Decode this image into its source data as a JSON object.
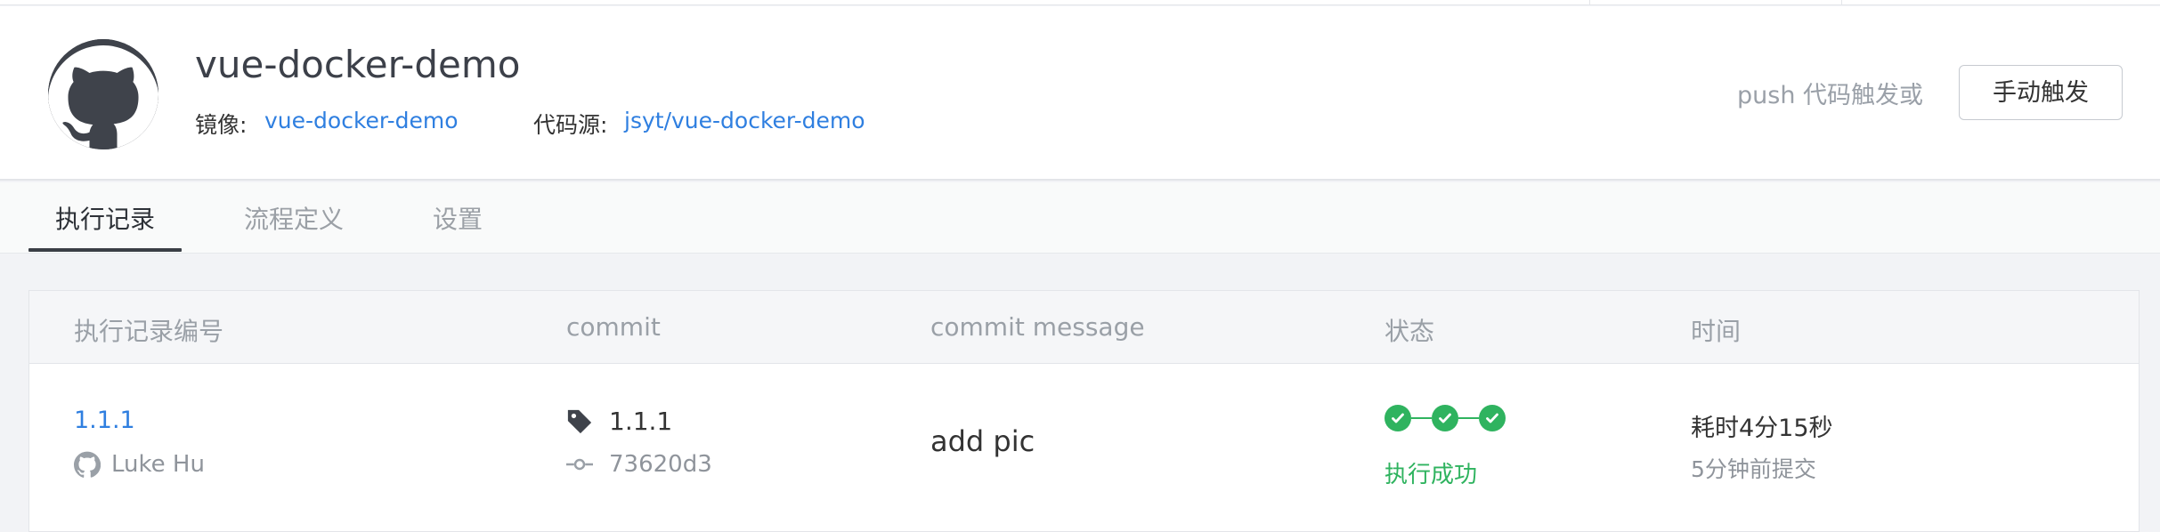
{
  "header": {
    "repo_name": "vue-docker-demo",
    "image_label": "镜像:",
    "image_value": "vue-docker-demo",
    "source_label": "代码源:",
    "source_value": "jsyt/vue-docker-demo",
    "trigger_hint": "push 代码触发或",
    "trigger_button": "手动触发",
    "avatar_icon": "github-octocat-icon"
  },
  "tabs": [
    {
      "label": "执行记录",
      "active": true
    },
    {
      "label": "流程定义",
      "active": false
    },
    {
      "label": "设置",
      "active": false
    }
  ],
  "table": {
    "columns": [
      "执行记录编号",
      "commit",
      "commit message",
      "状态",
      "时间"
    ],
    "rows": [
      {
        "run_id": "1.1.1",
        "author": "Luke Hu",
        "tag": "1.1.1",
        "commit_hash": "73620d3",
        "message": "add pic",
        "steps_completed": 3,
        "steps_total": 3,
        "status": "执行成功",
        "duration": "耗时4分15秒",
        "submitted": "5分钟前提交"
      }
    ]
  },
  "colors": {
    "link": "#2f7fe0",
    "success": "#2fb35f",
    "muted": "#9aa0a7"
  }
}
